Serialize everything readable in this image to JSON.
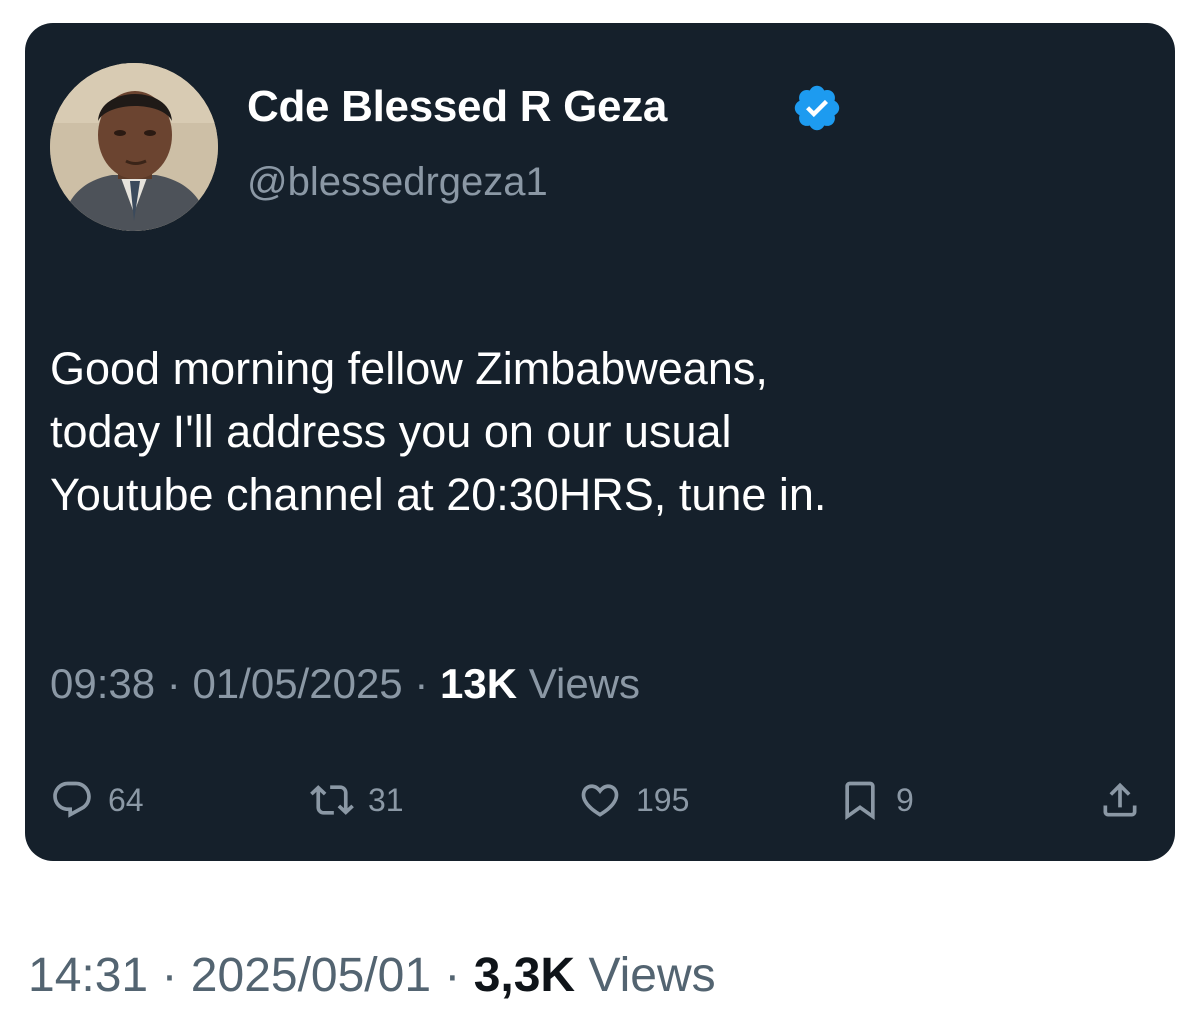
{
  "tweet": {
    "author_name": "Cde Blessed R Geza",
    "handle": "@blessedrgeza1",
    "verified": true,
    "verified_badge_color": "#1d9bf0",
    "text_lines": [
      "Good morning fellow Zimbabweans,",
      "today I'll address you on our usual",
      "Youtube channel at 20:30HRS, tune in."
    ],
    "time": "09:38",
    "separator": "·",
    "date": "01/05/2025",
    "views_count": "13K",
    "views_label": "Views",
    "actions": {
      "reply_icon": "reply-icon",
      "reply_count": "64",
      "retweet_icon": "retweet-icon",
      "retweet_count": "31",
      "like_icon": "heart-icon",
      "like_count": "195",
      "bookmark_icon": "bookmark-icon",
      "bookmark_count": "9",
      "share_icon": "share-icon"
    }
  },
  "post": {
    "time": "14:31",
    "separator": "·",
    "date": "2025/05/01",
    "views_count": "3,3K",
    "views_label": "Views"
  },
  "colors": {
    "card_background": "#15202b",
    "secondary_text": "#8b98a5",
    "primary_text": "#ffffff",
    "outer_secondary_text": "#536471",
    "outer_primary_text": "#0f1419"
  }
}
